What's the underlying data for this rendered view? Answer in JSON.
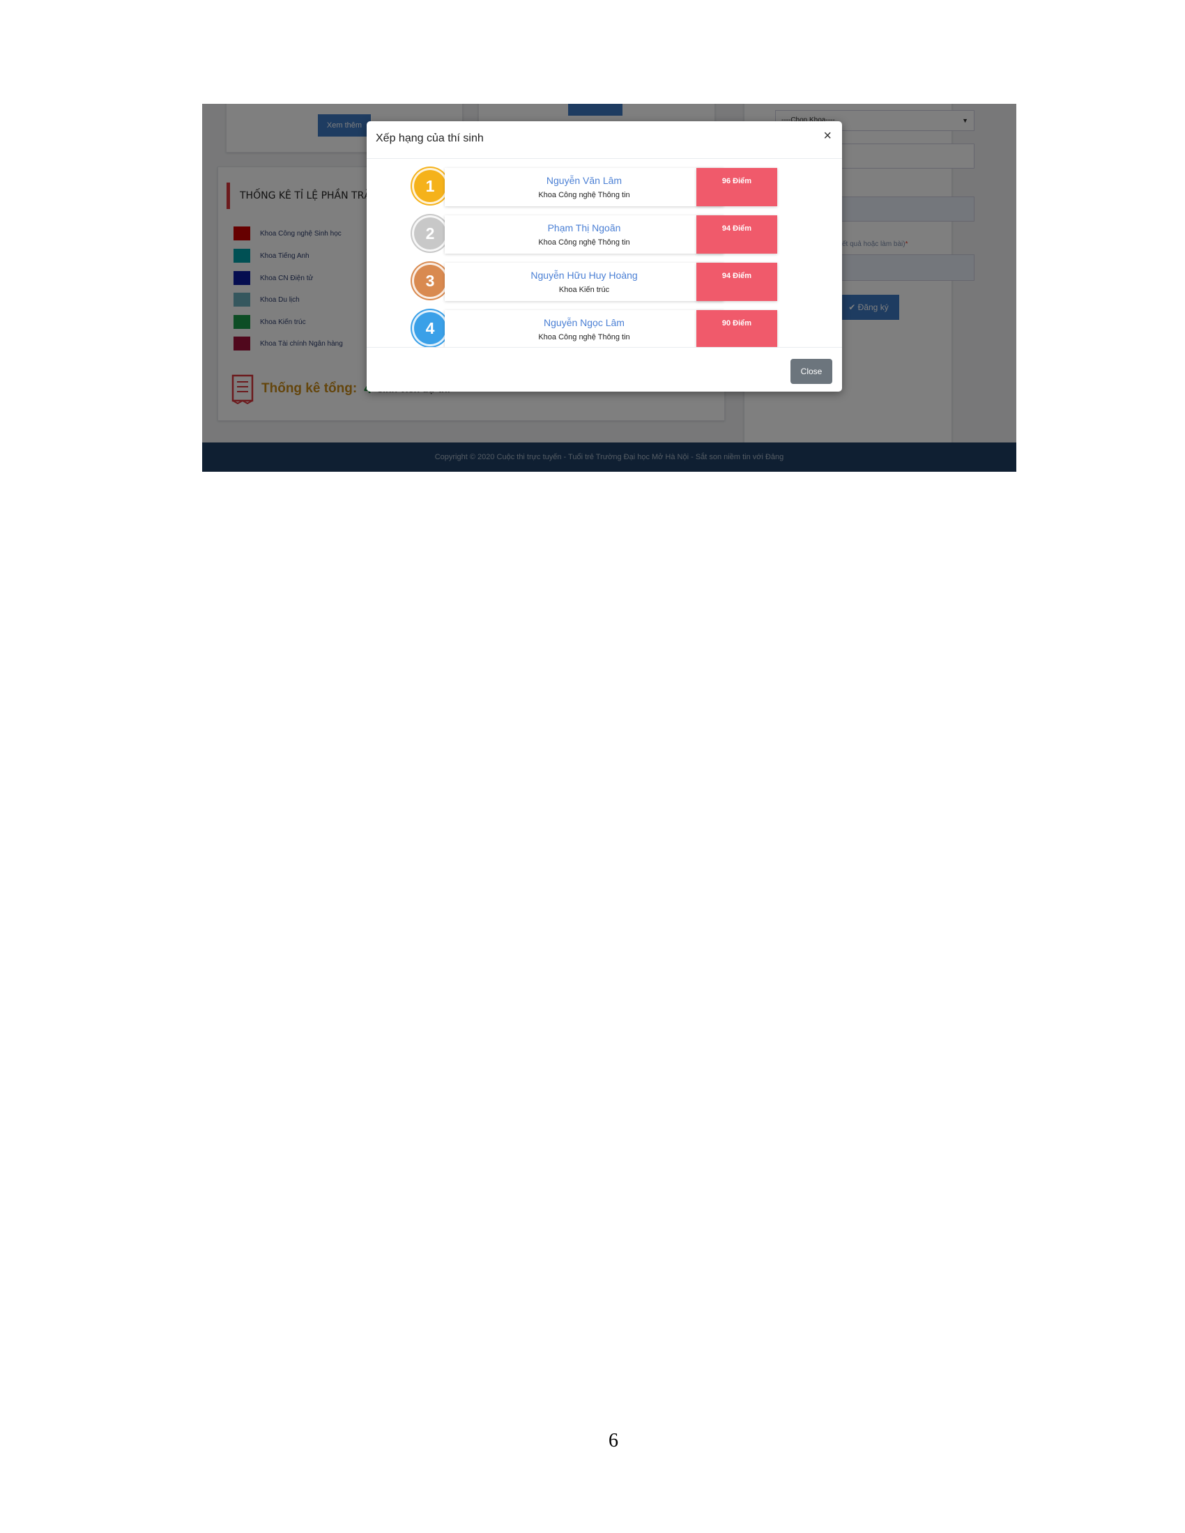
{
  "background": {
    "xem_them_label": "Xem thêm",
    "stats_title": "THỐNG KÊ TỈ LỆ PHẦN TRĂM",
    "legend": [
      {
        "label": "Khoa Công nghệ Sinh học",
        "color": "#cc0000"
      },
      {
        "label": "Khoa Tiếng Anh",
        "color": "#00a0a8"
      },
      {
        "label": "Khoa CN Điện tử",
        "color": "#0a1aa0"
      },
      {
        "label": "Khoa Du lịch",
        "color": "#6aaebd"
      },
      {
        "label": "Khoa Kiến trúc",
        "color": "#1a9a4a"
      },
      {
        "label": "Khoa Tài chính Ngân hàng",
        "color": "#a0103a"
      }
    ],
    "total_title": "Thống kê tổng:",
    "total_count": "4",
    "total_suffix": "sinh viên dự thi",
    "select_placeholder": "----Chọn Khoa----",
    "field_fragment": "v",
    "hint_text": "(xem kết quả hoặc làm bài)",
    "register_label": "Đăng ký",
    "footer_text": "Copyright © 2020 Cuộc thi trực tuyến - Tuổi trẻ Trường Đại học Mở Hà Nội - Sắt son niềm tin với Đảng"
  },
  "modal": {
    "title": "Xếp hạng của thí sinh",
    "close_x": "×",
    "close_button": "Close",
    "rankings": [
      {
        "rank": "1",
        "name": "Nguyễn Văn Lâm",
        "dept": "Khoa Công nghệ Thông tin",
        "score": "96 Điểm",
        "medal_color": "#f5b21b"
      },
      {
        "rank": "2",
        "name": "Phạm Thị Ngoãn",
        "dept": "Khoa Công nghệ Thông tin",
        "score": "94 Điểm",
        "medal_color": "#c8c8c8"
      },
      {
        "rank": "3",
        "name": "Nguyễn Hữu Huy Hoàng",
        "dept": "Khoa Kiến trúc",
        "score": "94 Điểm",
        "medal_color": "#d98a50"
      },
      {
        "rank": "4",
        "name": "Nguyễn Ngọc Lâm",
        "dept": "Khoa Công nghệ Thông tin",
        "score": "90 Điểm",
        "medal_color": "#3aa0e8"
      }
    ]
  },
  "page_number": "6"
}
